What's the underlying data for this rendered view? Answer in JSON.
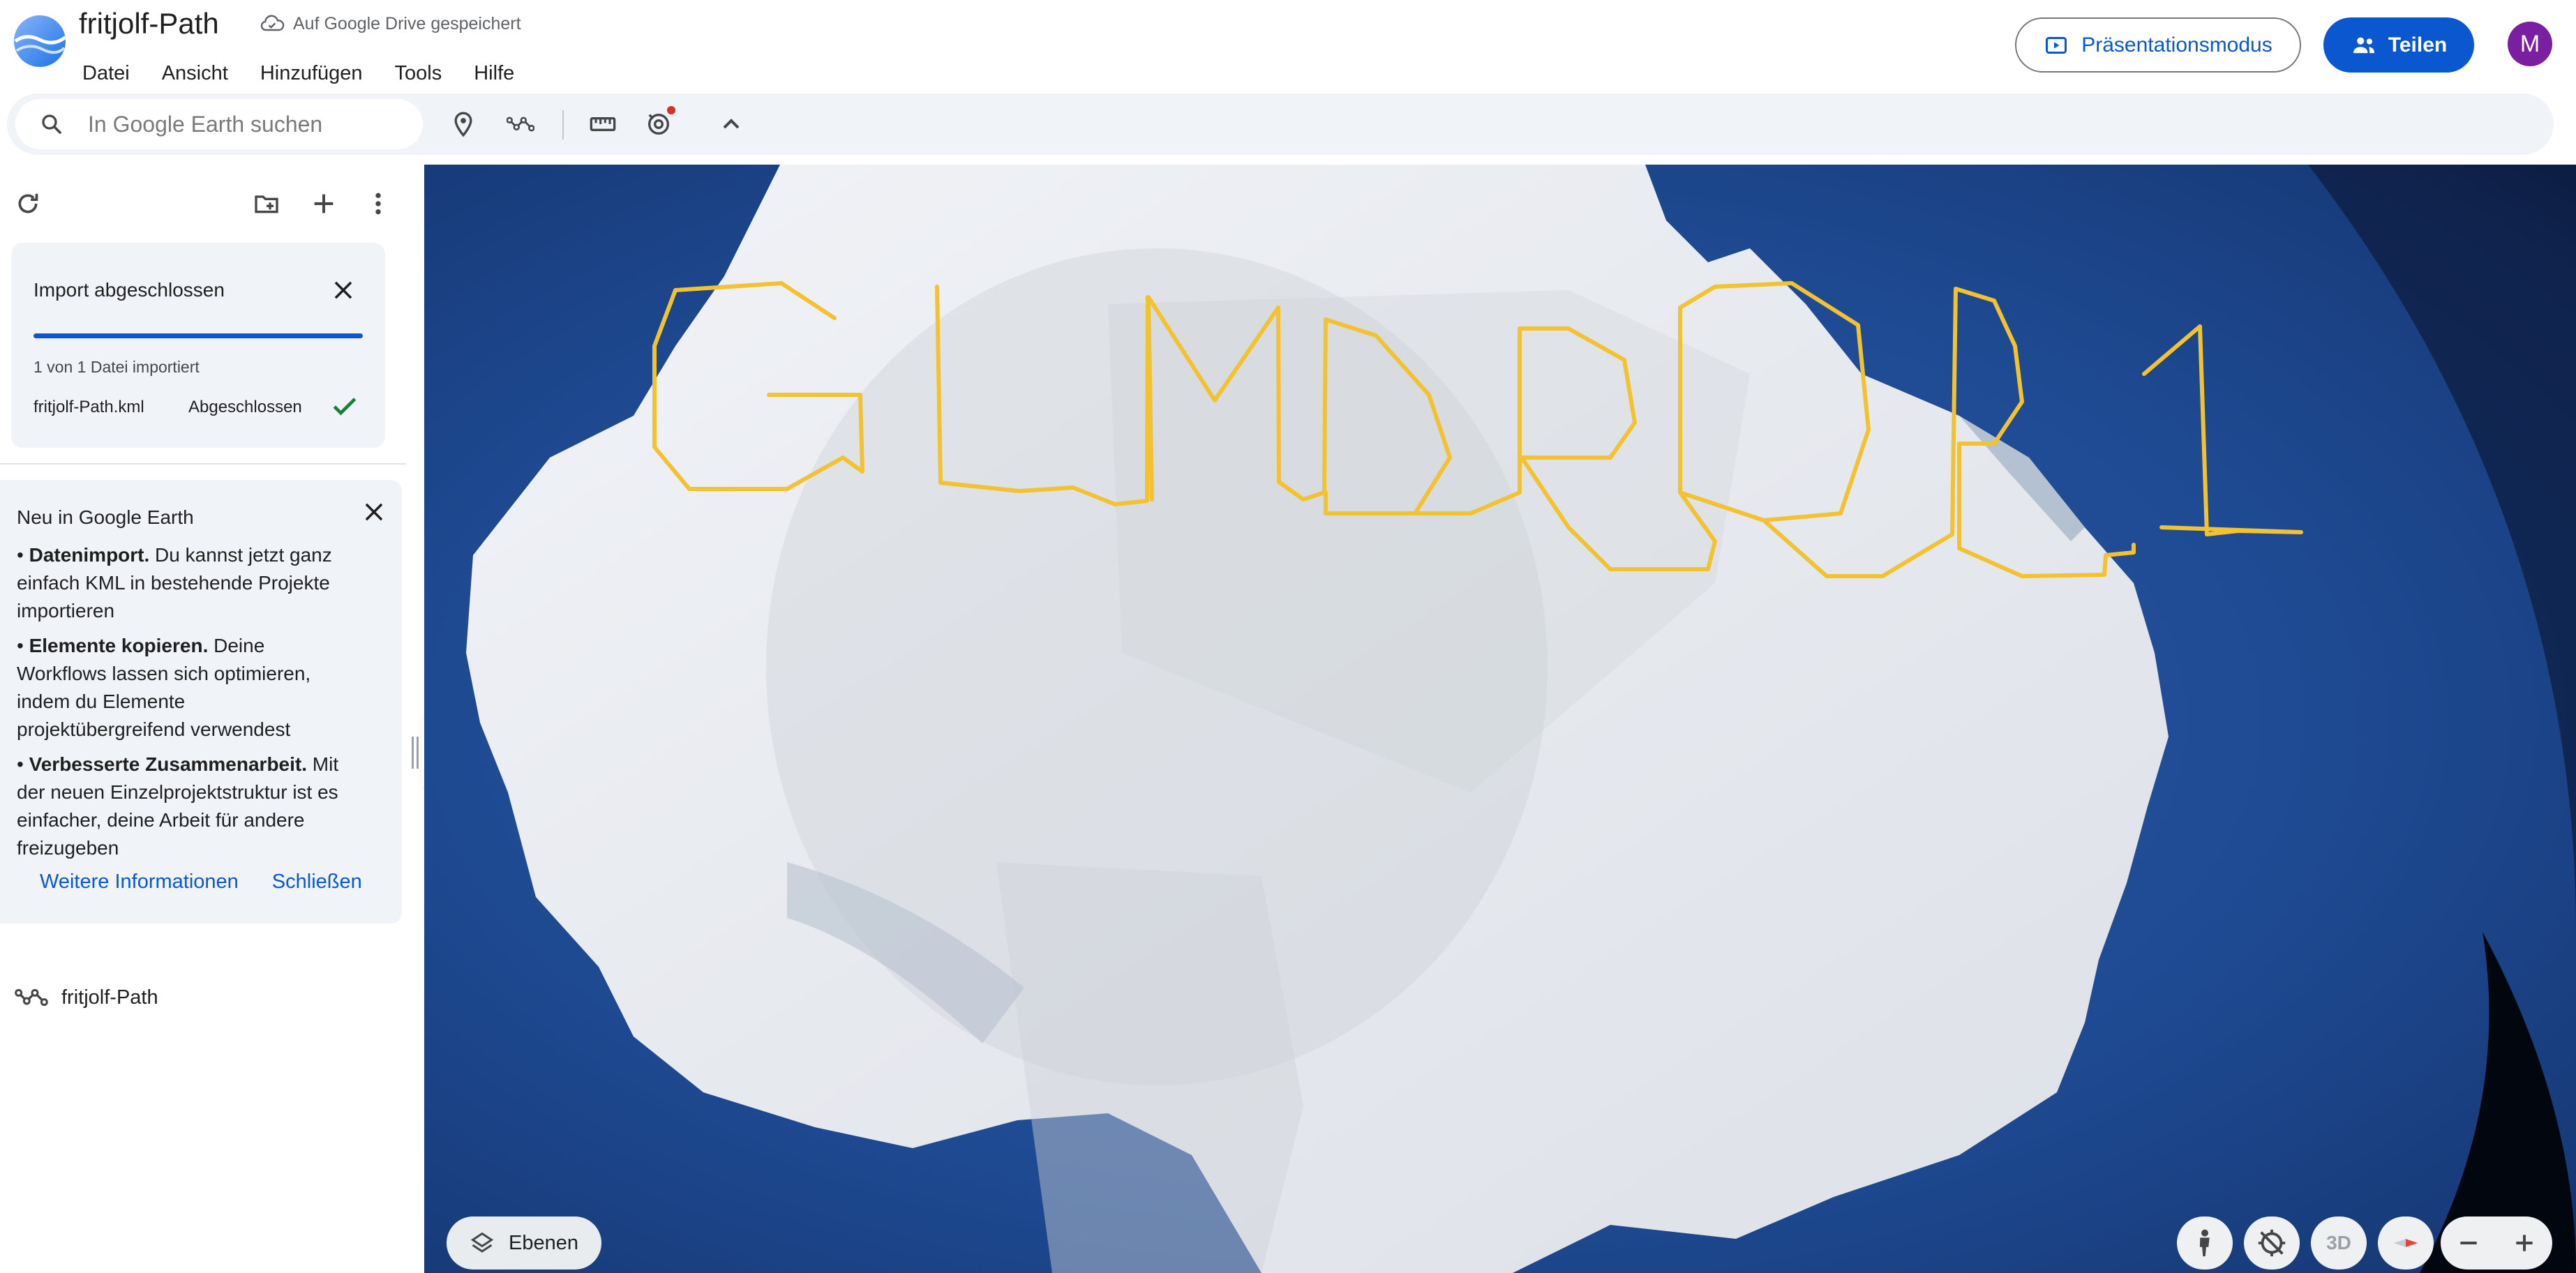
{
  "header": {
    "title": "fritjolf-Path",
    "save_status": "Auf Google Drive gespeichert",
    "menu": [
      "Datei",
      "Ansicht",
      "Hinzufügen",
      "Tools",
      "Hilfe"
    ],
    "present_label": "Präsentationsmodus",
    "share_label": "Teilen",
    "avatar_initial": "M",
    "avatar_color": "#7b1fa2"
  },
  "toolbar": {
    "search_placeholder": "In Google Earth suchen",
    "tools": [
      "placemark-icon",
      "path-icon",
      "ruler-icon",
      "history-icon",
      "chevron-up-icon"
    ]
  },
  "import": {
    "title": "Import abgeschlossen",
    "progress": 1.0,
    "count_text": "1 von 1 Datei importiert",
    "file_name": "fritjolf-Path.kml",
    "file_status": "Abgeschlossen"
  },
  "news": {
    "title": "Neu in Google Earth",
    "items": [
      {
        "bold": "Datenimport.",
        "text": " Du kannst jetzt ganz einfach KML in bestehende Projekte importieren"
      },
      {
        "bold": "Elemente kopieren.",
        "text": " Deine Workflows lassen sich optimieren, indem du Elemente projektübergreifend verwendest"
      },
      {
        "bold": "Verbesserte Zusammenarbeit.",
        "text": " Mit der neuen Einzelprojektstruktur ist es einfacher, deine Arbeit für andere freizugeben"
      }
    ],
    "more_label": "Weitere Informationen",
    "close_label": "Schließen"
  },
  "project_items": [
    {
      "label": "fritjolf-Path",
      "icon": "path-icon"
    }
  ],
  "map": {
    "layers_label": "Ebenen",
    "three_d_label": "3D",
    "path_color": "#f2c230",
    "ocean_color": "#1b3d78",
    "ice_color": "#e8ebf0"
  },
  "colors": {
    "accent": "#0b57d0",
    "panel_bg": "#f0f4f9"
  }
}
